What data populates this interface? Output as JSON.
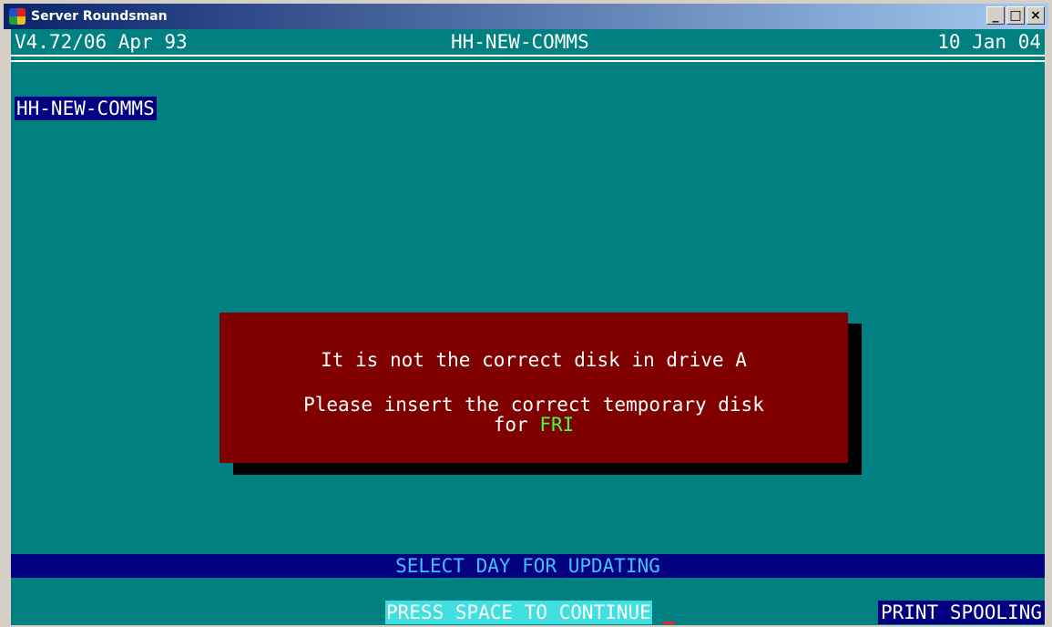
{
  "window": {
    "title": "Server Roundsman",
    "controls": {
      "minimize": "_",
      "maximize": "□",
      "close": "×"
    }
  },
  "header": {
    "version": "V4.72/06 Apr 93",
    "program": "HH-NEW-COMMS",
    "date": "10 Jan 04"
  },
  "screen_label": "HH-NEW-COMMS",
  "dialog": {
    "line1": "It is not the correct disk in drive A",
    "line2": "Please insert the correct temporary disk",
    "line3_prefix": "for ",
    "line3_day": "FRI"
  },
  "status_bar": "SELECT DAY FOR UPDATING",
  "footer": {
    "prompt": "PRESS SPACE TO CONTINUE",
    "spooling": "PRINT SPOOLING"
  },
  "colors": {
    "console_bg": "#008080",
    "dialog_bg": "#800000",
    "highlight_day": "#40ff40",
    "status_bg": "#000080"
  }
}
